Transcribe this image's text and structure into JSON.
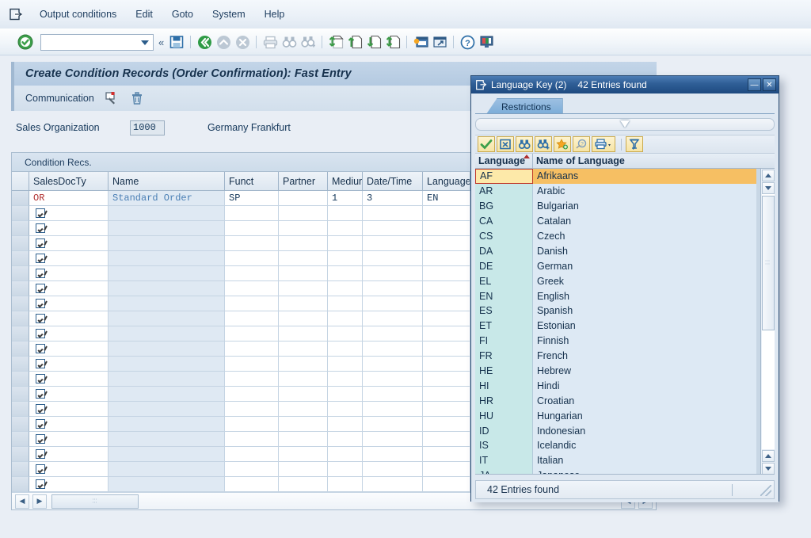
{
  "menubar": {
    "system_icon": "sap-session-icon",
    "items": [
      {
        "label": "Output conditions"
      },
      {
        "label": "Edit"
      },
      {
        "label": "Goto"
      },
      {
        "label": "System"
      },
      {
        "label": "Help"
      }
    ]
  },
  "toolbar": {
    "enter_icon": "green-check-enter-icon",
    "command_value": "",
    "command_placeholder": "",
    "icons": [
      {
        "name": "save-icon",
        "glyph": "save"
      },
      {
        "name": "back-icon",
        "glyph": "back"
      },
      {
        "name": "exit-icon",
        "glyph": "exit"
      },
      {
        "name": "cancel-icon",
        "glyph": "cancel"
      },
      {
        "name": "print-icon",
        "glyph": "print"
      },
      {
        "name": "find-icon",
        "glyph": "find"
      },
      {
        "name": "find-next-icon",
        "glyph": "findnext"
      },
      {
        "name": "first-page-icon",
        "glyph": "first"
      },
      {
        "name": "previous-page-icon",
        "glyph": "prev"
      },
      {
        "name": "next-page-icon",
        "glyph": "next"
      },
      {
        "name": "last-page-icon",
        "glyph": "last"
      },
      {
        "name": "create-session-icon",
        "glyph": "session"
      },
      {
        "name": "create-shortcut-icon",
        "glyph": "shortcut"
      },
      {
        "name": "help-icon",
        "glyph": "help"
      },
      {
        "name": "customize-local-layout-icon",
        "glyph": "layout"
      }
    ]
  },
  "main_window": {
    "title": "Create Condition Records (Order Confirmation): Fast Entry",
    "subbar": {
      "label": "Communication",
      "icon_comm": "communication-icon",
      "icon_delete": "trash-icon"
    },
    "sales_org": {
      "label": "Sales Organization",
      "value": "1000",
      "description": "Germany Frankfurt"
    },
    "table": {
      "caption": "Condition Recs.",
      "columns": [
        "SalesDocTy",
        "Name",
        "Funct",
        "Partner",
        "Medium",
        "Date/Time",
        "Language"
      ],
      "rows": [
        {
          "type": "data",
          "SalesDocTy": "OR",
          "Name": "Standard Order",
          "Funct": "SP",
          "Partner": "",
          "Medium": "1",
          "DateTime": "3",
          "Language": "EN"
        },
        {
          "type": "empty"
        },
        {
          "type": "empty"
        },
        {
          "type": "empty"
        },
        {
          "type": "empty"
        },
        {
          "type": "empty"
        },
        {
          "type": "empty"
        },
        {
          "type": "empty"
        },
        {
          "type": "empty"
        },
        {
          "type": "empty"
        },
        {
          "type": "empty"
        },
        {
          "type": "empty"
        },
        {
          "type": "empty"
        },
        {
          "type": "empty"
        },
        {
          "type": "empty"
        },
        {
          "type": "empty"
        },
        {
          "type": "empty"
        },
        {
          "type": "empty"
        },
        {
          "type": "empty"
        },
        {
          "type": "empty"
        }
      ]
    },
    "hscroll": {
      "left_arrow": "◀",
      "right_arrow": "▶"
    }
  },
  "dialog": {
    "icon": "sap-session-icon",
    "title": "Language Key (2)",
    "subtitle": "42 Entries found",
    "minimize_label": "—",
    "close_label": "✕",
    "tab_label": "Restrictions",
    "toolbar_icons": [
      {
        "name": "copy-selection-icon",
        "glyph": "check"
      },
      {
        "name": "cancel-icon",
        "glyph": "x-box"
      },
      {
        "name": "find-icon",
        "glyph": "binocular"
      },
      {
        "name": "find-next-icon",
        "glyph": "binocular-plus"
      },
      {
        "name": "insert-in-personal-list-icon",
        "glyph": "star"
      },
      {
        "name": "display-help-icon",
        "glyph": "hand-help"
      },
      {
        "name": "print-icon",
        "glyph": "printer"
      },
      {
        "name": "sort-filter-icon",
        "glyph": "funnel"
      }
    ],
    "list_columns": [
      "Language",
      "Name of Language"
    ],
    "sort_indicator": "ascending",
    "entries": [
      {
        "code": "AF",
        "name": "Afrikaans",
        "selected": true
      },
      {
        "code": "AR",
        "name": "Arabic",
        "selected": false
      },
      {
        "code": "BG",
        "name": "Bulgarian",
        "selected": false
      },
      {
        "code": "CA",
        "name": "Catalan",
        "selected": false
      },
      {
        "code": "CS",
        "name": "Czech",
        "selected": false
      },
      {
        "code": "DA",
        "name": "Danish",
        "selected": false
      },
      {
        "code": "DE",
        "name": "German",
        "selected": false
      },
      {
        "code": "EL",
        "name": "Greek",
        "selected": false
      },
      {
        "code": "EN",
        "name": "English",
        "selected": false
      },
      {
        "code": "ES",
        "name": "Spanish",
        "selected": false
      },
      {
        "code": "ET",
        "name": "Estonian",
        "selected": false
      },
      {
        "code": "FI",
        "name": "Finnish",
        "selected": false
      },
      {
        "code": "FR",
        "name": "French",
        "selected": false
      },
      {
        "code": "HE",
        "name": "Hebrew",
        "selected": false
      },
      {
        "code": "HI",
        "name": "Hindi",
        "selected": false
      },
      {
        "code": "HR",
        "name": "Croatian",
        "selected": false
      },
      {
        "code": "HU",
        "name": "Hungarian",
        "selected": false
      },
      {
        "code": "ID",
        "name": "Indonesian",
        "selected": false
      },
      {
        "code": "IS",
        "name": "Icelandic",
        "selected": false
      },
      {
        "code": "IT",
        "name": "Italian",
        "selected": false
      },
      {
        "code": "JA",
        "name": "Japanese",
        "selected": false
      }
    ],
    "status": "42 Entries found"
  },
  "colors": {
    "accent": "#1e4a80",
    "selection": "#f6bf63",
    "code_column": "#c8e8e8",
    "error_text": "#b03030",
    "link_text": "#4a7fb5"
  }
}
